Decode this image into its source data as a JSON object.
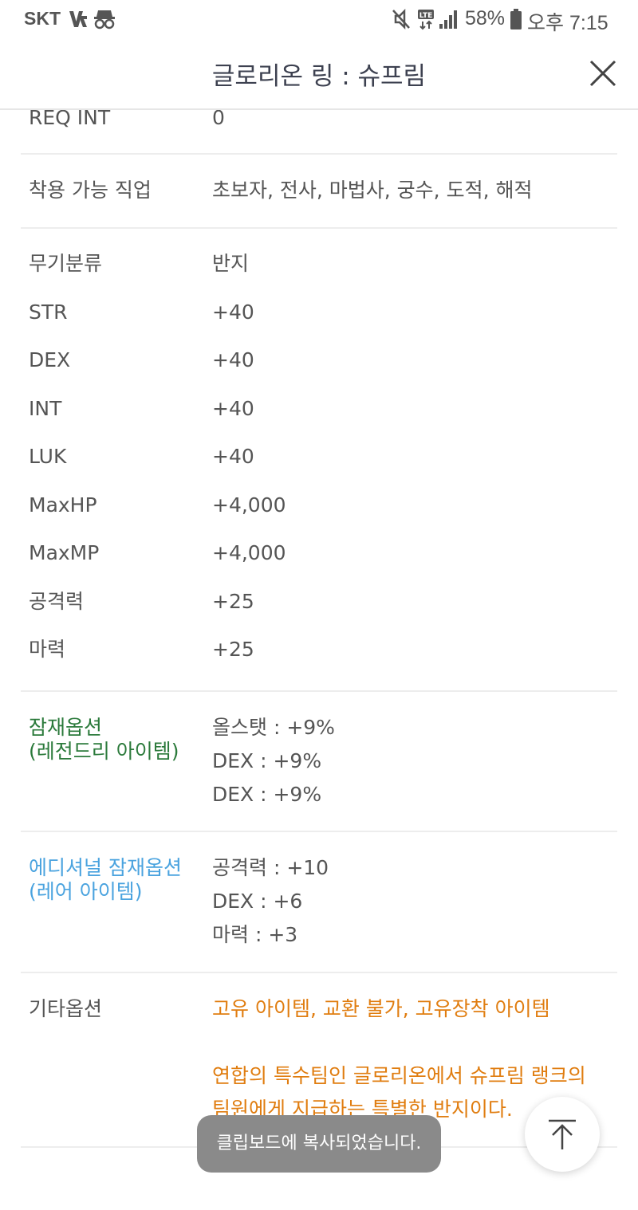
{
  "status_bar": {
    "carrier": "SKT",
    "battery": "58%",
    "time": "오후 7:15",
    "icons": [
      "vpn-key-icon",
      "incognito-icon",
      "mute-icon",
      "lte-icon",
      "signal-icon",
      "battery-icon"
    ]
  },
  "header": {
    "title": "글로리온 링 : 슈프림",
    "close_icon": "close-icon"
  },
  "stats": [
    {
      "label": "REQ INT",
      "value": "0"
    },
    {
      "label": "착용 가능 직업",
      "value": "초보자, 전사, 마법사, 궁수, 도적, 해적"
    },
    {
      "label": "무기분류",
      "value": "반지"
    },
    {
      "label": "STR",
      "value": "+40"
    },
    {
      "label": "DEX",
      "value": "+40"
    },
    {
      "label": "INT",
      "value": "+40"
    },
    {
      "label": "LUK",
      "value": "+40"
    },
    {
      "label": "MaxHP",
      "value": "+4,000"
    },
    {
      "label": "MaxMP",
      "value": "+4,000"
    },
    {
      "label": "공격력",
      "value": "+25"
    },
    {
      "label": "마력",
      "value": "+25"
    }
  ],
  "potential": {
    "label_line1": "잠재옵션",
    "label_line2": "(레전드리 아이템)",
    "lines": [
      "올스탯 : +9%",
      "DEX : +9%",
      "DEX : +9%"
    ],
    "color": "#2b7a3b"
  },
  "additional_potential": {
    "label_line1": "에디셔널 잠재옵션",
    "label_line2": "(레어 아이템)",
    "lines": [
      "공격력 : +10",
      "DEX : +6",
      "마력 : +3"
    ],
    "color": "#4aa3df"
  },
  "other": {
    "label": "기타옵션",
    "line1": "고유 아이템, 교환 불가, 고유장착 아이템",
    "desc_line1": "연합의 특수팀인 글로리온에서 슈프림 랭크의",
    "desc_line2": "팀원에게 지급하는 특별한 반지이다.",
    "color": "#e07d10"
  },
  "toast": {
    "text": "클립보드에 복사되었습니다."
  },
  "scroll_top": {
    "icon": "arrow-up-icon"
  }
}
